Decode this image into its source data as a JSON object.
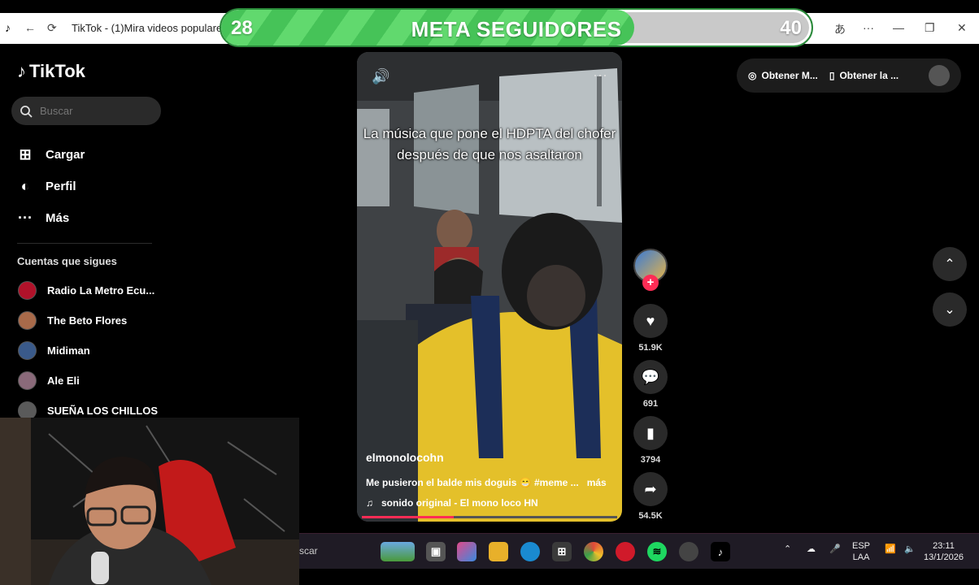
{
  "browser": {
    "tab_title": "TikTok - (1)Mira videos populares"
  },
  "goal_bar": {
    "current": "28",
    "title": "META SEGUIDORES",
    "target": "40",
    "progress": 0.7
  },
  "sidebar": {
    "logo": "TikTok",
    "search_placeholder": "Buscar",
    "nav": [
      {
        "label": "Cargar"
      },
      {
        "label": "Perfil"
      },
      {
        "label": "Más"
      }
    ],
    "following_title": "Cuentas que sigues",
    "following": [
      {
        "name": "Radio La Metro Ecu..."
      },
      {
        "name": "The Beto Flores"
      },
      {
        "name": "Midiman"
      },
      {
        "name": "Ale Eli"
      },
      {
        "name": "SUEÑA LOS CHILLOS"
      }
    ]
  },
  "video": {
    "caption": "La música que pone el HDPTA del chofer después de que nos asaltaron",
    "username": "elmonolocohn",
    "description": "Me pusieron el balde mis doguis 😁 #meme ...",
    "more": "más",
    "sound": "sonido original - El mono loco HN",
    "progress": 0.36
  },
  "actions": {
    "likes": "51.9K",
    "comments": "691",
    "saves": "3794",
    "shares": "54.5K"
  },
  "top_right": {
    "get_coins": "Obtener M...",
    "get_app": "Obtener la ..."
  },
  "taskbar": {
    "search": "scar",
    "lang_top": "ESP",
    "lang_bottom": "LAA",
    "time": "23:11",
    "date": "13/1/2026"
  }
}
